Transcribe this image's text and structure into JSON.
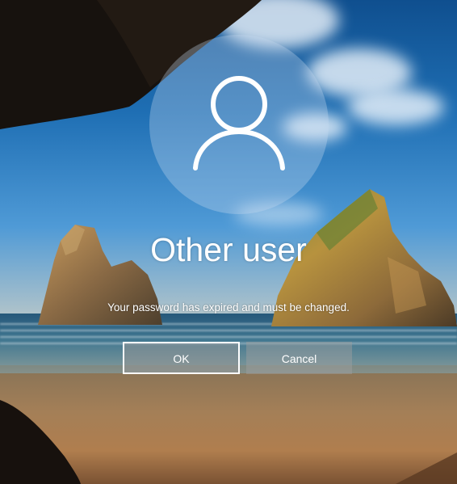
{
  "login": {
    "avatar_icon": "user-icon",
    "username": "Other user",
    "message": "Your password has expired and must be changed.",
    "ok_label": "OK",
    "cancel_label": "Cancel"
  },
  "background": {
    "scene": "beach-cave-landscape",
    "sky_color": "#1f6fb4",
    "sand_color": "#a47f57"
  }
}
